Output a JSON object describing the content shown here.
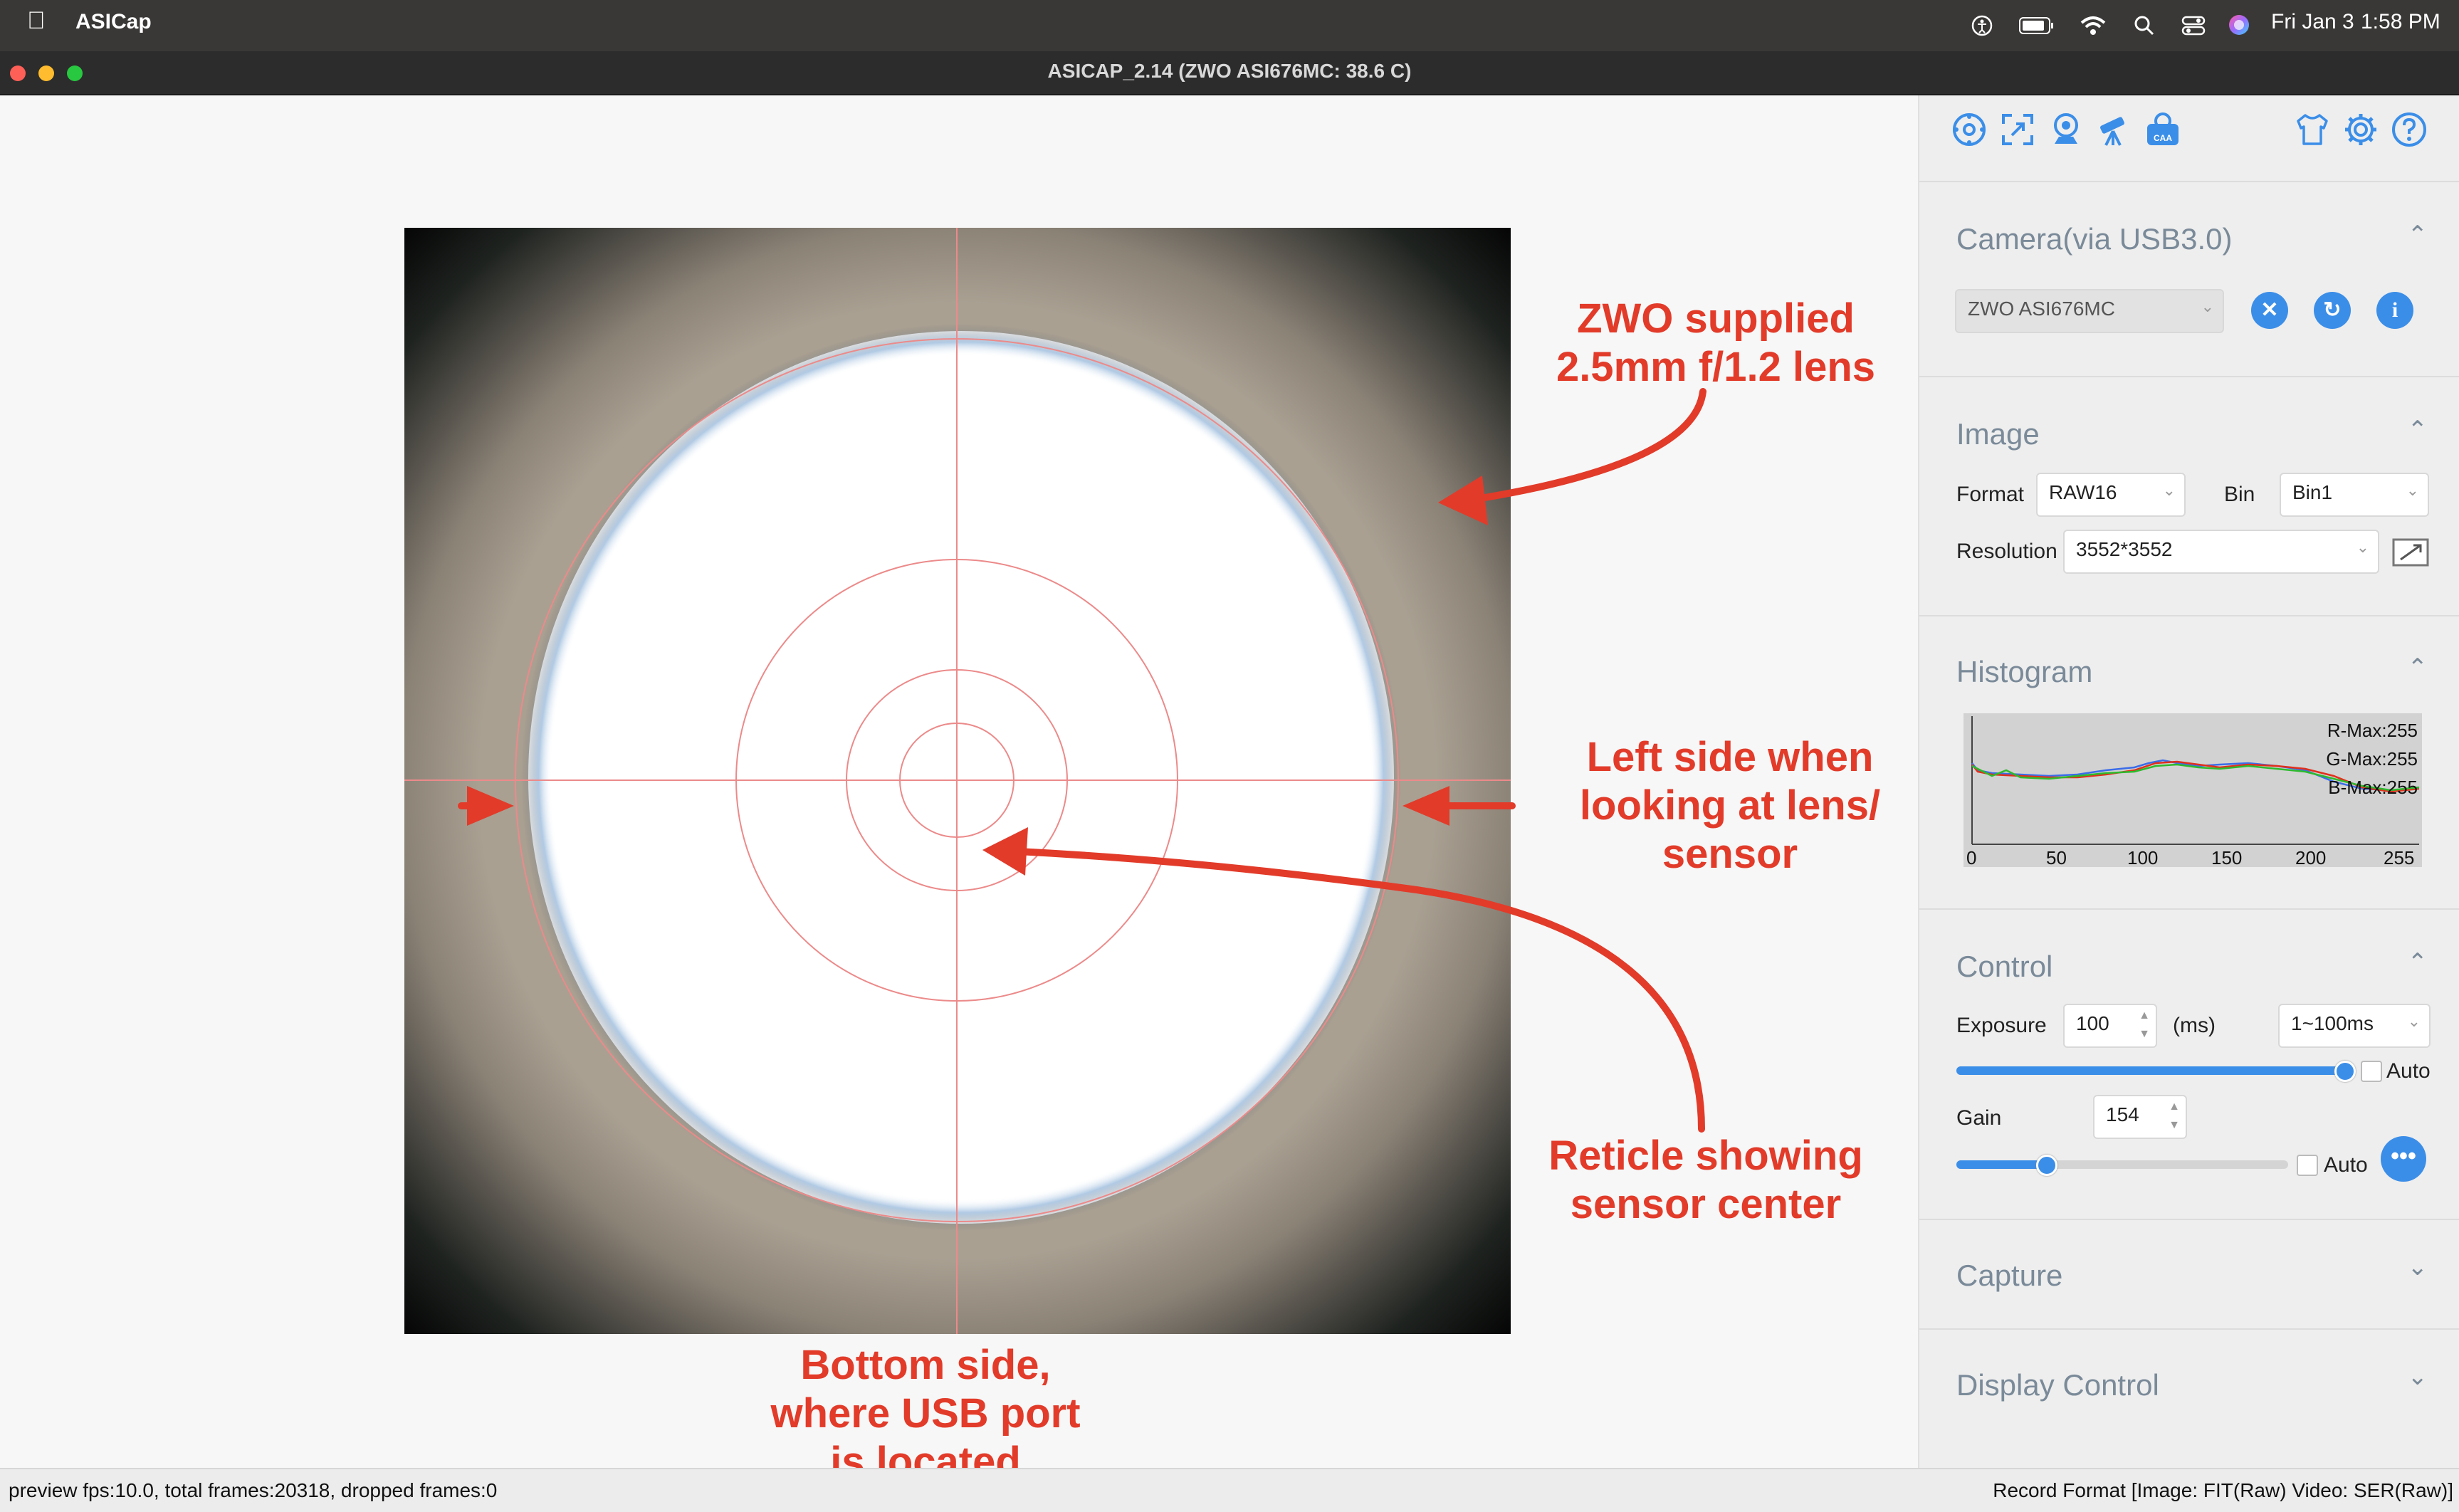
{
  "menubar": {
    "app_name": "ASICap",
    "date": "Fri Jan 3",
    "time": "1:58 PM",
    "icons": [
      "apple-icon",
      "accessibility-icon",
      "battery-icon",
      "wifi-icon",
      "spotlight-search-icon",
      "control-center-icon",
      "siri-icon"
    ]
  },
  "window": {
    "title": "ASICAP_2.14 (ZWO ASI676MC: 38.6 C)"
  },
  "toolbar": {
    "icons": [
      "aperture-icon",
      "focus-assist-icon",
      "webcam-icon",
      "telescope-icon",
      "caa-icon",
      "skin-shirt-icon",
      "settings-gear-icon",
      "help-icon"
    ]
  },
  "camera": {
    "section_title": "Camera(via USB3.0)",
    "selected_camera": "ZWO ASI676MC"
  },
  "image": {
    "section_title": "Image",
    "format_label": "Format",
    "format_value": "RAW16",
    "bin_label": "Bin",
    "bin_value": "Bin1",
    "resolution_label": "Resolution",
    "resolution_value": "3552*3552"
  },
  "histogram": {
    "section_title": "Histogram",
    "r_max": "R-Max:255",
    "g_max": "G-Max:255",
    "b_max": "B-Max:255",
    "x_ticks": [
      "0",
      "50",
      "100",
      "150",
      "200",
      "255"
    ]
  },
  "control": {
    "section_title": "Control",
    "exposure_label": "Exposure",
    "exposure_value": "100",
    "exposure_unit": "(ms)",
    "exposure_range": "1~100ms",
    "exposure_slider_fraction": 0.995,
    "auto_label": "Auto",
    "gain_label": "Gain",
    "gain_value": "154",
    "gain_slider_fraction": 0.27,
    "gain_auto_label": "Auto"
  },
  "capture": {
    "section_title": "Capture"
  },
  "display_control": {
    "section_title": "Display Control"
  },
  "status": {
    "left": "preview fps:10.0, total frames:20318, dropped frames:0",
    "right": "Record Format [Image: FIT(Raw) Video: SER(Raw)]"
  },
  "annotations": {
    "lens_line1": "ZWO supplied",
    "lens_line2": "2.5mm f/1.2 lens",
    "left_line1": "Left side when",
    "left_line2": "looking at lens/",
    "left_line3": "sensor",
    "reticle_line1": "Reticle showing",
    "reticle_line2": "sensor center",
    "bottom_line1": "Bottom side,",
    "bottom_line2": "where USB port",
    "bottom_line3": "is located"
  },
  "colors": {
    "accent": "#3b8ee8",
    "annotation": "#e23b2a",
    "reticle": "#e88a8a"
  }
}
